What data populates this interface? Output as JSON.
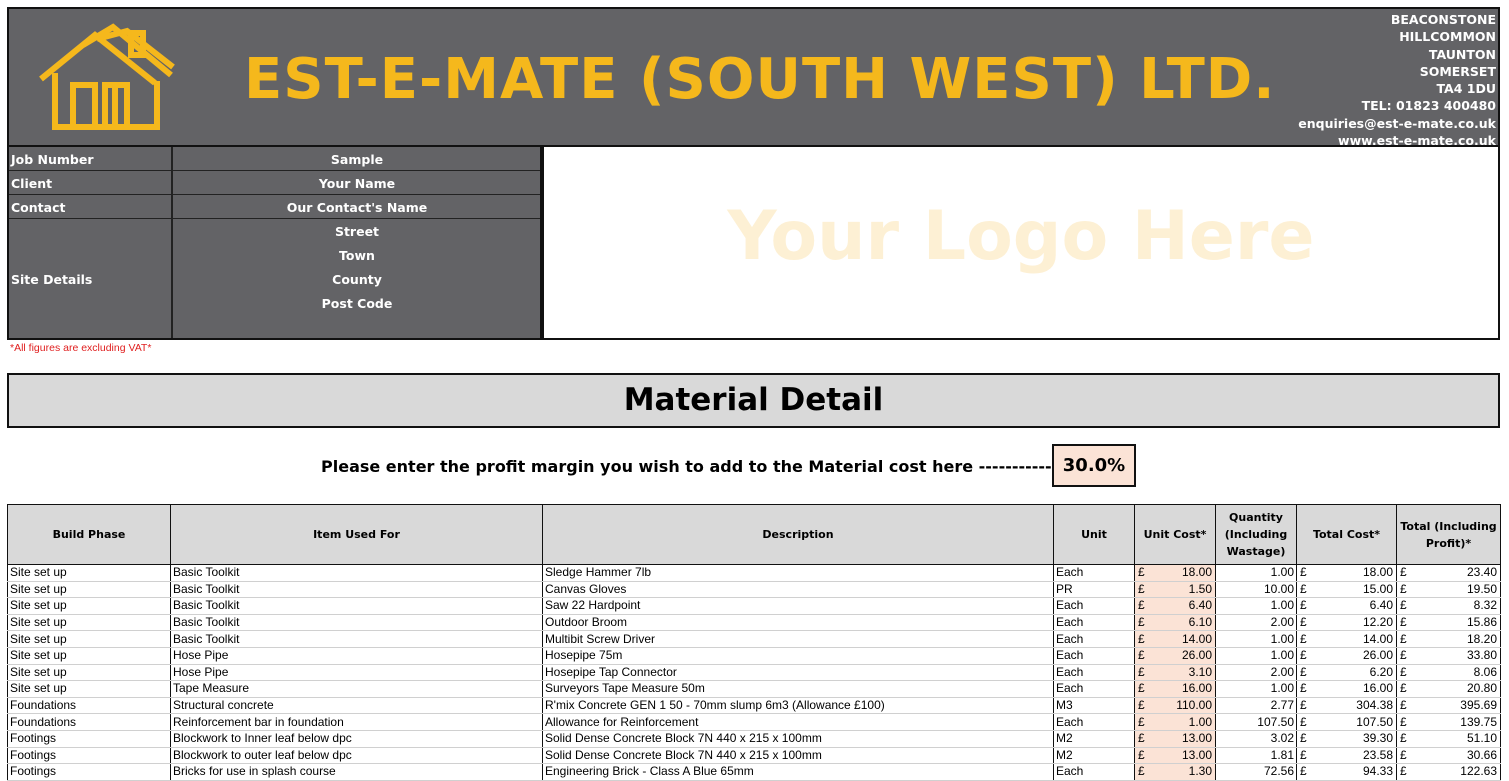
{
  "company": {
    "name": "EST-E-MATE (SOUTH WEST) LTD.",
    "address_lines": [
      "BEACONSTONE",
      "HILLCOMMON",
      "TAUNTON",
      "SOMERSET",
      "TA4 1DU",
      "TEL: 01823 400480",
      "enquiries@est-e-mate.co.uk",
      "www.est-e-mate.co.uk"
    ],
    "logo_icon": "house-icon",
    "brand_color": "#f5b81c",
    "banner_color": "#636366"
  },
  "job": {
    "job_number_label": "Job Number",
    "job_number": "Sample",
    "client_label": "Client",
    "client": "Your Name",
    "contact_label": "Contact",
    "contact": "Our Contact's Name",
    "site_label": "Site Details",
    "site_lines": [
      "Street",
      "Town",
      "County",
      "Post Code"
    ]
  },
  "logo_placeholder": "Your Logo Here",
  "vat_note": "*All figures are excluding VAT*",
  "section_title": "Material Detail",
  "margin": {
    "prompt": "Please enter the profit margin you wish to add to the Material cost here ----------->",
    "value": "30.0%"
  },
  "table": {
    "currency": "£",
    "headers": [
      "Build Phase",
      "Item Used For",
      "Description",
      "Unit",
      "Unit Cost*",
      "Quantity (Including Wastage)",
      "Total Cost*",
      "Total (Including Profit)*"
    ],
    "rows": [
      [
        "Site set up",
        "Basic Toolkit",
        "Sledge Hammer 7lb",
        "Each",
        "18.00",
        "1.00",
        "18.00",
        "23.40"
      ],
      [
        "Site set up",
        "Basic Toolkit",
        "Canvas Gloves",
        "PR",
        "1.50",
        "10.00",
        "15.00",
        "19.50"
      ],
      [
        "Site set up",
        "Basic Toolkit",
        "Saw 22 Hardpoint",
        "Each",
        "6.40",
        "1.00",
        "6.40",
        "8.32"
      ],
      [
        "Site set up",
        "Basic Toolkit",
        "Outdoor Broom",
        "Each",
        "6.10",
        "2.00",
        "12.20",
        "15.86"
      ],
      [
        "Site set up",
        "Basic Toolkit",
        "Multibit Screw Driver",
        "Each",
        "14.00",
        "1.00",
        "14.00",
        "18.20"
      ],
      [
        "Site set up",
        "Hose Pipe",
        "Hosepipe 75m",
        "Each",
        "26.00",
        "1.00",
        "26.00",
        "33.80"
      ],
      [
        "Site set up",
        "Hose Pipe",
        "Hosepipe Tap Connector",
        "Each",
        "3.10",
        "2.00",
        "6.20",
        "8.06"
      ],
      [
        "Site set up",
        "Tape Measure",
        "Surveyors Tape Measure 50m",
        "Each",
        "16.00",
        "1.00",
        "16.00",
        "20.80"
      ],
      [
        "Foundations",
        "Structural concrete",
        "R'mix Concrete GEN 1 50 - 70mm slump 6m3 (Allowance £100)",
        "M3",
        "110.00",
        "2.77",
        "304.38",
        "395.69"
      ],
      [
        "Foundations",
        "Reinforcement bar in foundation",
        "Allowance for Reinforcement",
        "Each",
        "1.00",
        "107.50",
        "107.50",
        "139.75"
      ],
      [
        "Footings",
        "Blockwork to Inner leaf below dpc",
        "Solid Dense Concrete Block 7N 440 x 215 x 100mm",
        "M2",
        "13.00",
        "3.02",
        "39.30",
        "51.10"
      ],
      [
        "Footings",
        "Blockwork to outer leaf below dpc",
        "Solid Dense Concrete Block 7N 440 x 215 x 100mm",
        "M2",
        "13.00",
        "1.81",
        "23.58",
        "30.66"
      ],
      [
        "Footings",
        "Bricks for use in splash course",
        "Engineering Brick - Class A Blue 65mm",
        "Each",
        "1.30",
        "72.56",
        "94.33",
        "122.63"
      ]
    ]
  }
}
